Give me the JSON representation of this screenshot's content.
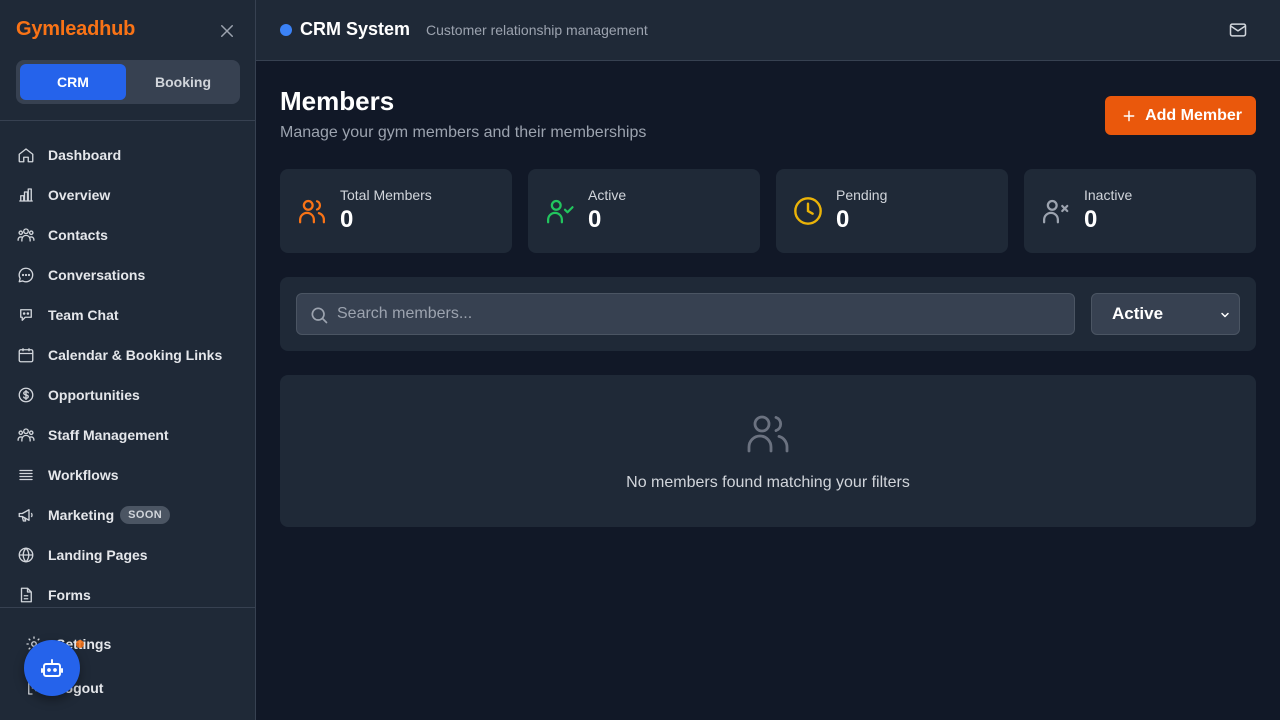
{
  "sidebar": {
    "brand": "Gymleadhub",
    "modes": [
      "CRM",
      "Booking"
    ],
    "active_mode": "CRM",
    "items": [
      {
        "label": "Dashboard",
        "icon": "home-icon"
      },
      {
        "label": "Overview",
        "icon": "bar-chart-icon"
      },
      {
        "label": "Contacts",
        "icon": "users-icon"
      },
      {
        "label": "Conversations",
        "icon": "message-circle-icon"
      },
      {
        "label": "Team Chat",
        "icon": "chat-bot-icon"
      },
      {
        "label": "Calendar & Booking Links",
        "icon": "calendar-icon"
      },
      {
        "label": "Opportunities",
        "icon": "dollar-circle-icon"
      },
      {
        "label": "Staff Management",
        "icon": "users-icon"
      },
      {
        "label": "Workflows",
        "icon": "list-icon"
      },
      {
        "label": "Marketing",
        "icon": "megaphone-icon",
        "badge": "SOON"
      },
      {
        "label": "Landing Pages",
        "icon": "globe-icon"
      },
      {
        "label": "Forms",
        "icon": "file-icon"
      }
    ],
    "bottom": {
      "settings": "Settings",
      "logout": "Logout"
    }
  },
  "topbar": {
    "title": "CRM System",
    "subtitle": "Customer relationship management"
  },
  "main": {
    "title": "Members",
    "subtitle": "Manage your gym members and their memberships",
    "add_button": "Add Member",
    "stats": [
      {
        "label": "Total Members",
        "value": "0",
        "icon": "users-icon",
        "color": "#f97316"
      },
      {
        "label": "Active",
        "value": "0",
        "icon": "user-check-icon",
        "color": "#22c55e"
      },
      {
        "label": "Pending",
        "value": "0",
        "icon": "clock-icon",
        "color": "#eab308"
      },
      {
        "label": "Inactive",
        "value": "0",
        "icon": "user-x-icon",
        "color": "#9ca3af"
      }
    ],
    "search": {
      "placeholder": "Search members..."
    },
    "status_filter": {
      "selected": "Active"
    },
    "empty_message": "No members found matching your filters"
  },
  "colors": {
    "accent": "#2563eb",
    "brand": "#f97316",
    "add_button": "#ea580c",
    "background": "#111827",
    "panel": "#1f2937"
  }
}
